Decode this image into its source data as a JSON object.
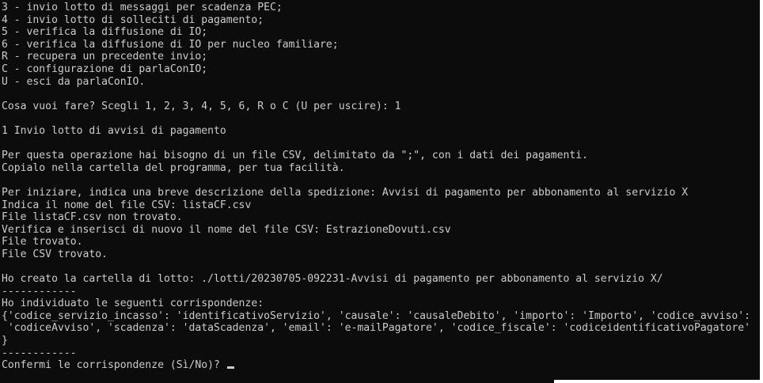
{
  "terminal": {
    "lines": [
      "3 - invio lotto di messaggi per scadenza PEC;",
      "4 - invio lotto di solleciti di pagamento;",
      "5 - verifica la diffusione di IO;",
      "6 - verifica la diffusione di IO per nucleo familiare;",
      "R - recupera un precedente invio;",
      "C - configurazione di parlaConIO;",
      "U - esci da parlaConIO.",
      "",
      "Cosa vuoi fare? Scegli 1, 2, 3, 4, 5, 6, R o C (U per uscire): 1",
      "",
      "1 Invio lotto di avvisi di pagamento",
      "",
      "Per questa operazione hai bisogno di un file CSV, delimitato da \";\", con i dati dei pagamenti.",
      "Copialo nella cartella del programma, per tua facilità.",
      "",
      "Per iniziare, indica una breve descrizione della spedizione: Avvisi di pagamento per abbonamento al servizio X",
      "Indica il nome del file CSV: listaCF.csv",
      "File listaCF.csv non trovato.",
      "Verifica e inserisci di nuovo il nome del file CSV: EstrazioneDovuti.csv",
      "File trovato.",
      "File CSV trovato.",
      "",
      "Ho creato la cartella di lotto: ./lotti/20230705-092231-Avvisi di pagamento per abbonamento al servizio X/",
      "------------",
      "Ho individuato le seguenti corrispondenze:",
      "{'codice_servizio_incasso': 'identificativoServizio', 'causale': 'causaleDebito', 'importo': 'Importo', 'codice_avviso':",
      " 'codiceAvviso', 'scadenza': 'dataScadenza', 'email': 'e-mailPagatore', 'codice_fiscale': 'codiceidentificativoPagatore'",
      "}",
      "------------"
    ],
    "prompt": "Confermi le corrispondenze (Sì/No)? "
  }
}
